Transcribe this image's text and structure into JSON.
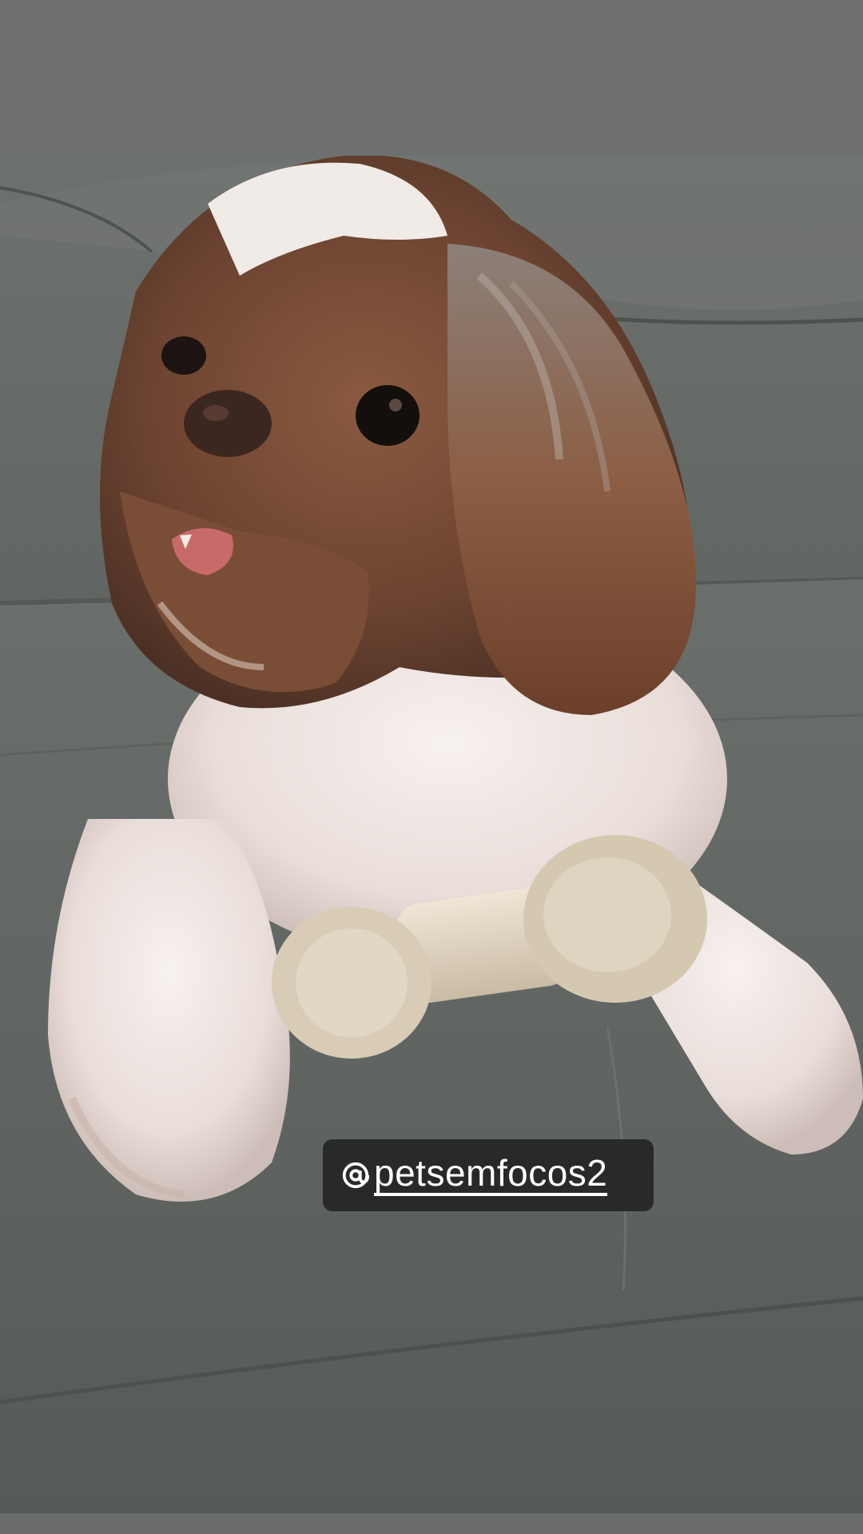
{
  "story": {
    "background_color": "#6e706f",
    "mention": {
      "handle": "petsemfocos2",
      "icon": "at-sign-icon"
    }
  },
  "photo": {
    "subject": "dog",
    "object": "bone",
    "scene": "sofa"
  }
}
